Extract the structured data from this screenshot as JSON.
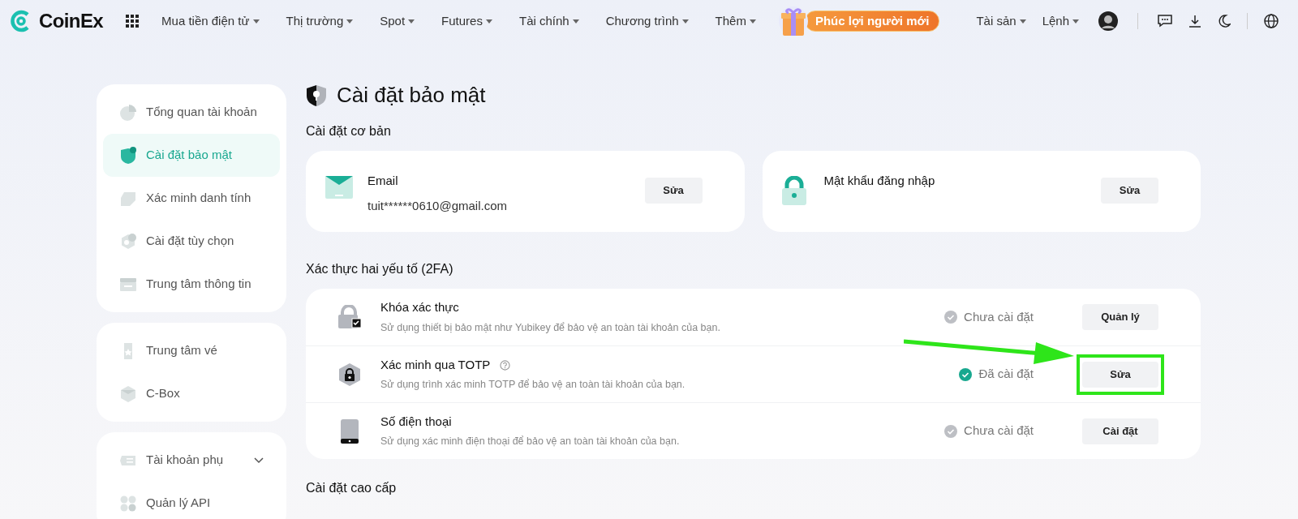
{
  "nav": {
    "logo": "CoinEx",
    "menu": [
      {
        "label": "Mua tiền điện tử"
      },
      {
        "label": "Thị trường"
      },
      {
        "label": "Spot"
      },
      {
        "label": "Futures"
      },
      {
        "label": "Tài chính"
      },
      {
        "label": "Chương trình"
      },
      {
        "label": "Thêm"
      }
    ],
    "promo": "Phúc lợi người mới",
    "right_menu": [
      {
        "label": "Tài sản"
      },
      {
        "label": "Lệnh"
      }
    ]
  },
  "sidebar": {
    "groups": [
      {
        "items": [
          {
            "label": "Tổng quan tài khoản",
            "selected": false
          },
          {
            "label": "Cài đặt bảo mật",
            "selected": true
          },
          {
            "label": "Xác minh danh tính",
            "selected": false
          },
          {
            "label": "Cài đặt tùy chọn",
            "selected": false
          },
          {
            "label": "Trung tâm thông tin",
            "selected": false
          }
        ]
      },
      {
        "items": [
          {
            "label": "Trung tâm vé",
            "selected": false
          },
          {
            "label": "C-Box",
            "selected": false
          }
        ]
      },
      {
        "items": [
          {
            "label": "Tài khoản phụ",
            "selected": false,
            "expandable": true
          },
          {
            "label": "Quản lý API",
            "selected": false,
            "expandable": false
          }
        ]
      }
    ]
  },
  "page": {
    "title": "Cài đặt bảo mật",
    "basic": {
      "heading": "Cài đặt cơ bản",
      "cards": [
        {
          "title": "Email",
          "value": "tuit******0610@gmail.com",
          "button": "Sửa"
        },
        {
          "title": "Mật khẩu đăng nhập",
          "button": "Sửa"
        }
      ]
    },
    "twofa": {
      "heading": "Xác thực hai yếu tố (2FA)",
      "rows": [
        {
          "title": "Khóa xác thực",
          "description": "Sử dụng thiết bị bảo mật như Yubikey để bảo vệ an toàn tài khoản của bạn.",
          "status": "Chưa cài đặt",
          "done": false,
          "button": "Quản lý"
        },
        {
          "title": "Xác minh qua TOTP",
          "help": true,
          "description": "Sử dụng trình xác minh TOTP để bảo vệ an toàn tài khoản của bạn.",
          "status": "Đã cài đặt",
          "done": true,
          "button": "Sửa",
          "highlighted": true
        },
        {
          "title": "Số điện thoại",
          "description": "Sử dụng xác minh điện thoại để bảo vệ an toàn tài khoản của bạn.",
          "status": "Chưa cài đặt",
          "done": false,
          "button": "Cài đặt"
        }
      ]
    },
    "advanced": {
      "heading": "Cài đặt cao cấp"
    }
  }
}
